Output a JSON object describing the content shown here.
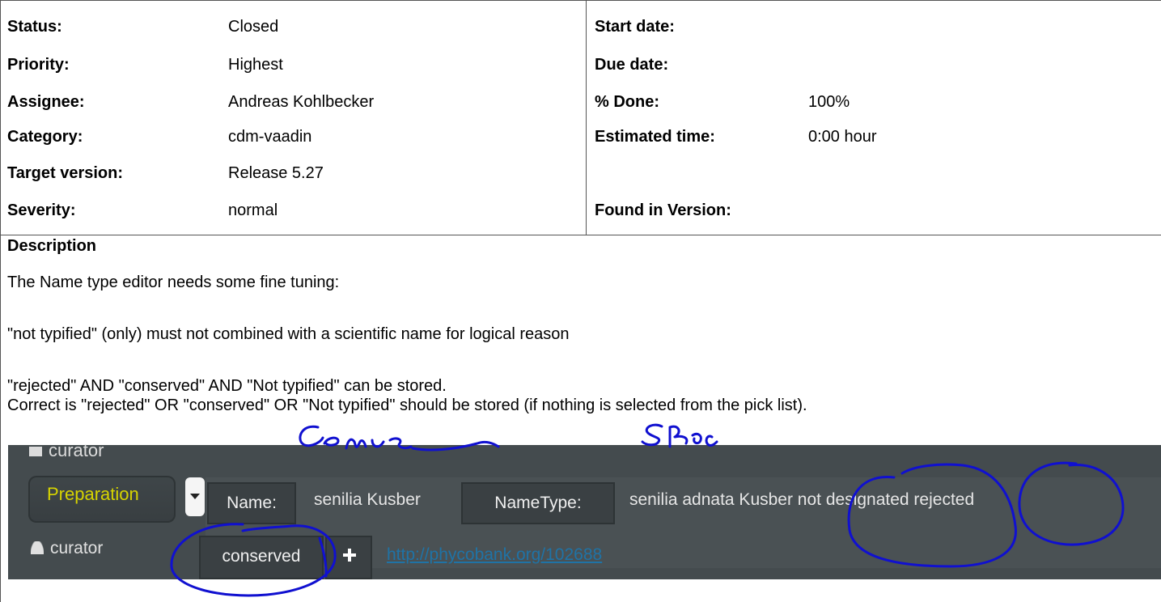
{
  "attributes": {
    "left": [
      {
        "label": "Status:",
        "value": "Closed"
      },
      {
        "label": "Priority:",
        "value": "Highest"
      },
      {
        "label": "Assignee:",
        "value": "Andreas Kohlbecker"
      },
      {
        "label": "Category:",
        "value": "cdm-vaadin"
      },
      {
        "label": "Target version:",
        "value": "Release 5.27"
      },
      {
        "label": "Severity:",
        "value": "normal"
      }
    ],
    "right": [
      {
        "label": "Start date:",
        "value": ""
      },
      {
        "label": "Due date:",
        "value": ""
      },
      {
        "label": "% Done:",
        "value": "100%"
      },
      {
        "label": "Estimated time:",
        "value": "0:00 hour"
      },
      {
        "label": "",
        "value": ""
      },
      {
        "label": "Found in Version:",
        "value": ""
      }
    ]
  },
  "description": {
    "title": "Description",
    "lines": [
      "The Name type editor needs some fine tuning:",
      "\"not typified\" (only) must not combined with a scientific name for logical reason",
      "\"rejected\" AND \"conserved\" AND \"Not typified\" can be stored.",
      "Correct is \"rejected\" OR \"conserved\" OR \"Not typified\" should be stored (if nothing is selected from the pick list)."
    ]
  },
  "screenshot": {
    "ghost_label": "curator",
    "select_value": "Preparation",
    "role_label": "curator",
    "name_chip": "Name:",
    "name_value": "senilia Kusber",
    "nametype_chip": "NameType:",
    "nametype_value": "senilia adnata Kusber not designated rejected",
    "conserved_chip": "conserved",
    "link": "http://phycobank.org/102688"
  },
  "annotations": {
    "genus": "Genus",
    "spec": "Spec"
  },
  "colors": {
    "bar": "#444b4e",
    "select_text": "#d7d400",
    "link": "#1f73a6",
    "pen": "#1010d0"
  }
}
